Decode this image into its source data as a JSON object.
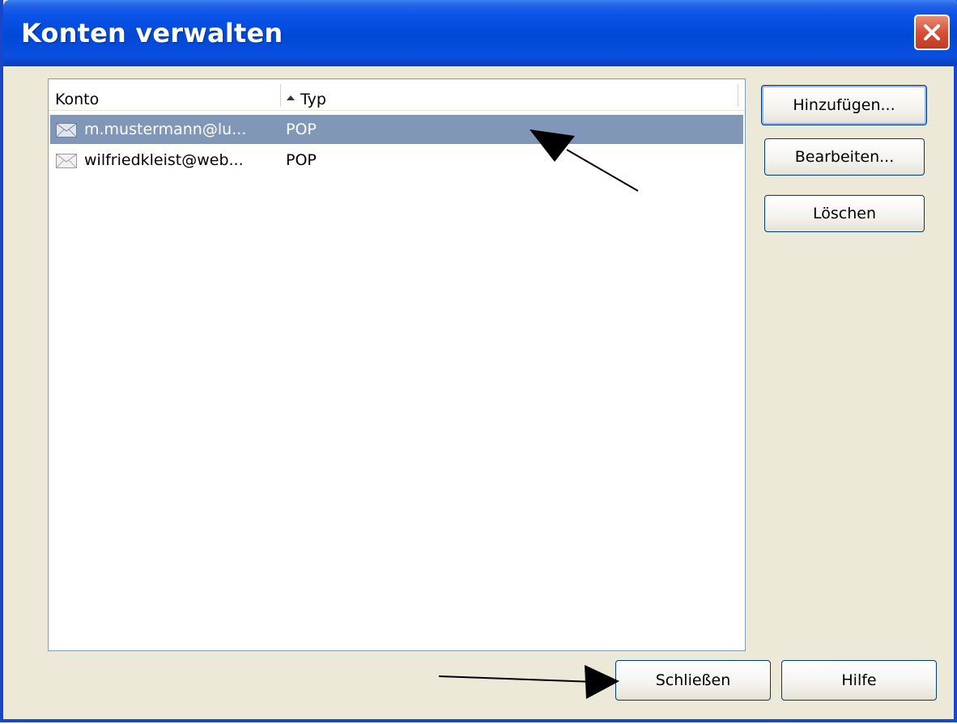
{
  "window": {
    "title": "Konten verwalten"
  },
  "list": {
    "columns": [
      {
        "label": "Konto"
      },
      {
        "label": "Typ",
        "sort": "ascending"
      }
    ],
    "rows": [
      {
        "account": "m.mustermann@lu...",
        "type": "POP",
        "selected": true,
        "icon": "envelope-icon"
      },
      {
        "account": "wilfriedkleist@web...",
        "type": "POP",
        "selected": false,
        "icon": "envelope-icon"
      }
    ]
  },
  "buttons": {
    "add": "Hinzufügen...",
    "edit": "Bearbeiten...",
    "delete": "Löschen",
    "close": "Schließen",
    "help": "Hilfe"
  },
  "colors": {
    "titlebar": "#0048d6",
    "selection": "#8197b8",
    "close_button": "#d6503a",
    "dialog_bg": "#ece9d8"
  }
}
